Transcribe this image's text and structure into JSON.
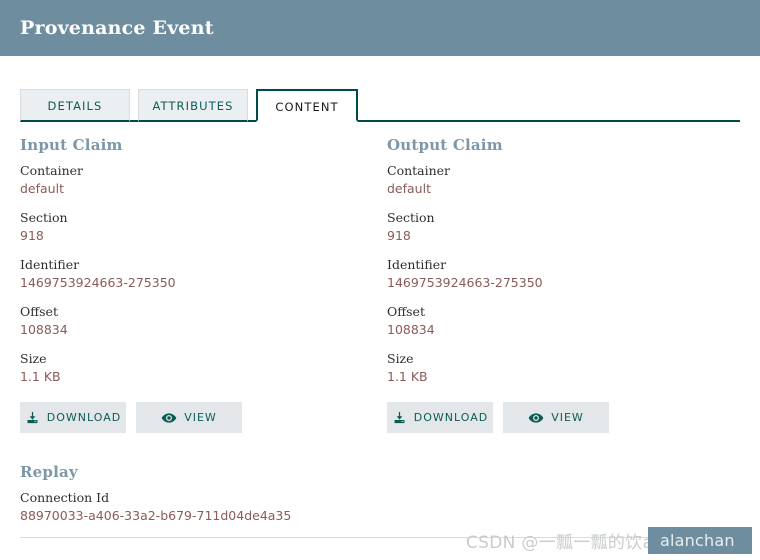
{
  "header": {
    "title": "Provenance Event",
    "bg_color": "#6e8d9e"
  },
  "tabs": [
    {
      "label": "DETAILS",
      "active": false
    },
    {
      "label": "ATTRIBUTES",
      "active": false
    },
    {
      "label": "CONTENT",
      "active": true
    }
  ],
  "claims": [
    {
      "heading": "Input Claim",
      "fields": [
        {
          "label": "Container",
          "value": "default"
        },
        {
          "label": "Section",
          "value": "918"
        },
        {
          "label": "Identifier",
          "value": "1469753924663-275350"
        },
        {
          "label": "Offset",
          "value": "108834"
        },
        {
          "label": "Size",
          "value": "1.1 KB"
        }
      ],
      "buttons": [
        {
          "label": "DOWNLOAD",
          "icon": "download-icon"
        },
        {
          "label": "VIEW",
          "icon": "eye-icon"
        }
      ]
    },
    {
      "heading": "Output Claim",
      "fields": [
        {
          "label": "Container",
          "value": "default"
        },
        {
          "label": "Section",
          "value": "918"
        },
        {
          "label": "Identifier",
          "value": "1469753924663-275350"
        },
        {
          "label": "Offset",
          "value": "108834"
        },
        {
          "label": "Size",
          "value": "1.1 KB"
        }
      ],
      "buttons": [
        {
          "label": "DOWNLOAD",
          "icon": "download-icon"
        },
        {
          "label": "VIEW",
          "icon": "eye-icon"
        }
      ]
    }
  ],
  "replay": {
    "heading": "Replay",
    "fields": [
      {
        "label": "Connection Id",
        "value": "88970033-a406-33a2-b679-711d04de4a35"
      }
    ]
  },
  "watermark": {
    "text": "CSDN @一瓢一瓢的饮alanchan",
    "badge": "alanchan",
    "accent_color": "#6e8d9e"
  },
  "colors": {
    "accent_teal": "#004a4a",
    "heading_blue": "#7b97a9",
    "value_red": "#8a5b59",
    "tab_inactive_bg": "#eceff1",
    "button_bg": "#e3e7e9"
  }
}
